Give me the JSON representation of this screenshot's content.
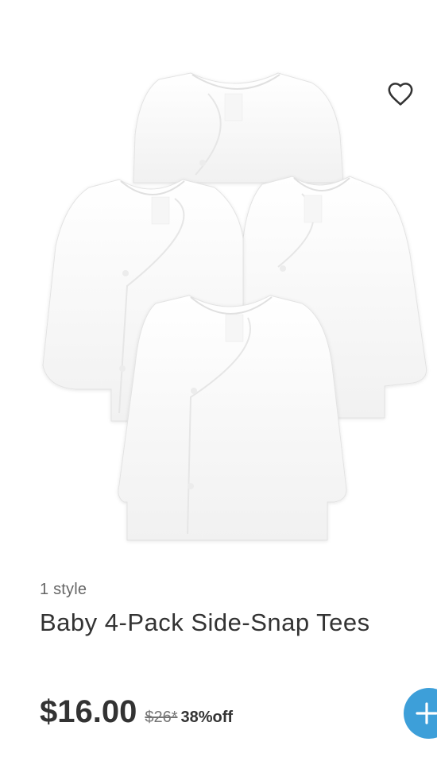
{
  "product": {
    "style_count": "1 style",
    "title": "Baby 4-Pack Side-Snap Tees",
    "price": "$16.00",
    "original_price": "$26*",
    "discount": "38%off",
    "image_alt": "Baby 4-Pack Side-Snap Tees"
  },
  "icons": {
    "favorite": "heart-outline-icon",
    "add": "plus-icon"
  },
  "colors": {
    "accent": "#3d9fd9",
    "text": "#333333",
    "muted": "#757575"
  }
}
